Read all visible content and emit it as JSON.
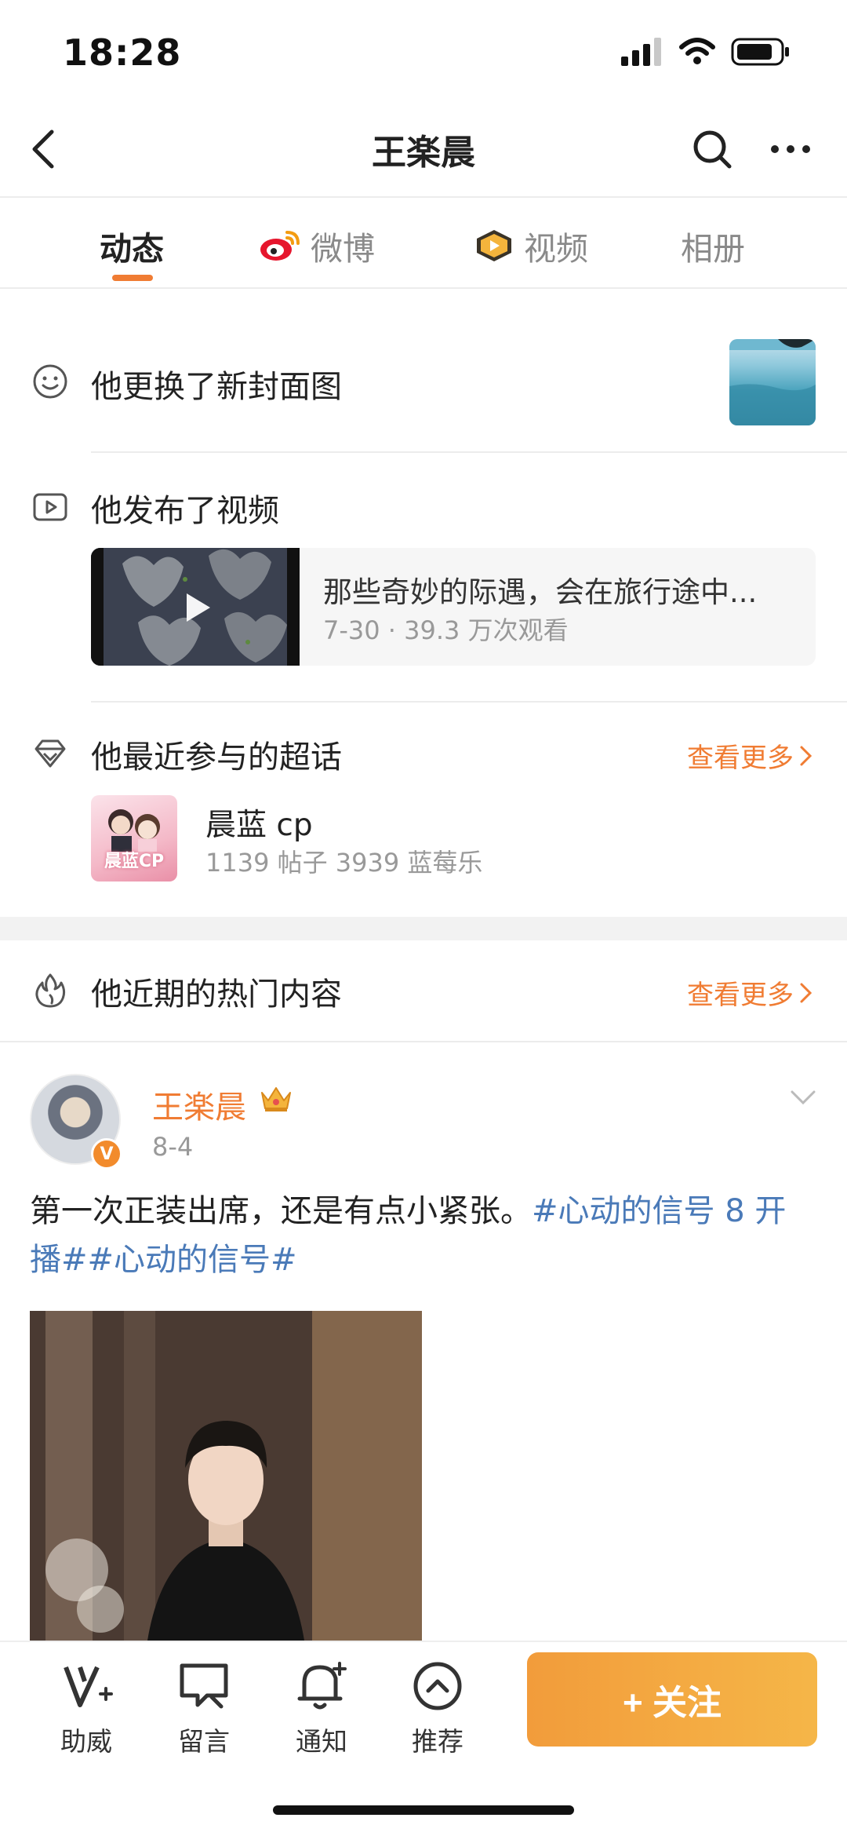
{
  "status_bar": {
    "time": "18:28"
  },
  "nav": {
    "title": "王楽晨"
  },
  "tabs": [
    {
      "label": "动态",
      "icon": ""
    },
    {
      "label": "微博",
      "icon": "weibo-logo-icon"
    },
    {
      "label": "视频",
      "icon": "video-play-badge-icon"
    },
    {
      "label": "相册",
      "icon": ""
    }
  ],
  "activity": {
    "cover_change": {
      "label": "他更换了新封面图"
    },
    "video_post": {
      "label": "他发布了视频",
      "video_title": "那些奇妙的际遇，会在旅行途中...",
      "video_meta": "7-30 · 39.3 万次观看"
    },
    "super_topics": {
      "label": "他最近参与的超话",
      "see_more": "查看更多",
      "topic_name": "晨蓝 cp",
      "topic_stats": "1139 帖子 3939 蓝莓乐",
      "topic_thumb_text": "晨蓝CP"
    },
    "hot_content": {
      "label": "他近期的热门内容",
      "see_more": "查看更多"
    }
  },
  "post": {
    "author": "王楽晨",
    "date": "8-4",
    "text": "第一次正装出席，还是有点小紧张。",
    "hashtags": "#心动的信号 8 开播##心动的信号#"
  },
  "bottom_bar": {
    "items": [
      {
        "label": "助威",
        "icon": "cheer-v-icon"
      },
      {
        "label": "留言",
        "icon": "message-icon"
      },
      {
        "label": "通知",
        "icon": "bell-plus-icon"
      },
      {
        "label": "推荐",
        "icon": "chevron-up-circle-icon"
      }
    ],
    "follow_label": "+ 关注"
  },
  "colors": {
    "accent": "#f07c33",
    "hashtag": "#4a7ab8",
    "follow_button": "#f5a840"
  }
}
